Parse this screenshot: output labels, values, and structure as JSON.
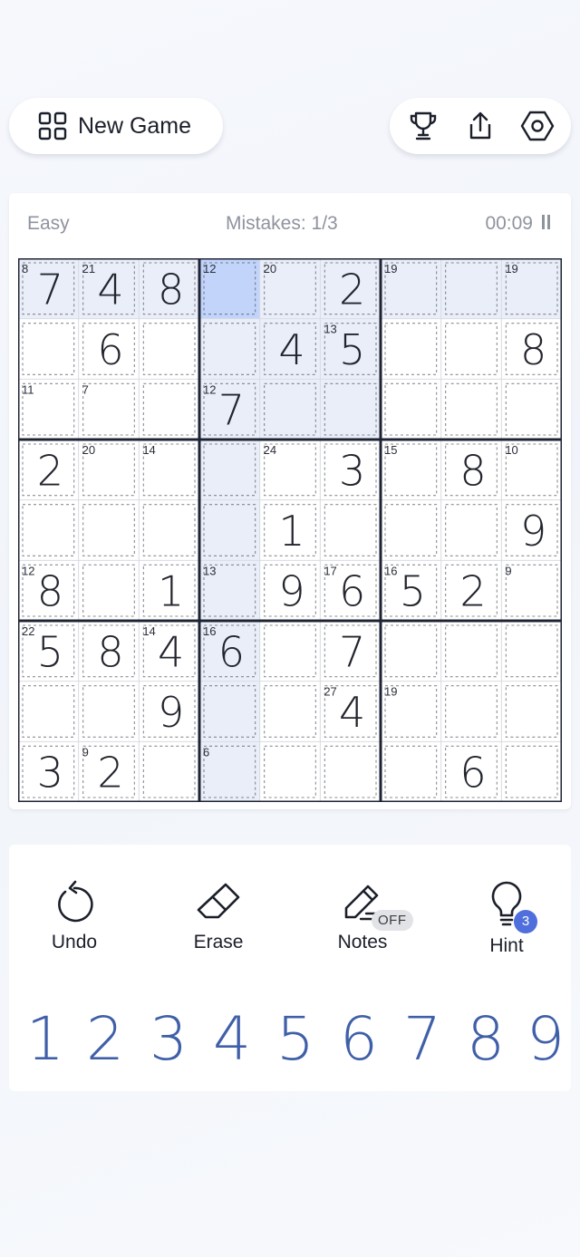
{
  "header": {
    "new_game_label": "New Game",
    "icons": [
      "grid-icon",
      "trophy-icon",
      "share-icon",
      "settings-icon"
    ]
  },
  "status": {
    "difficulty": "Easy",
    "mistakes": "Mistakes: 1/3",
    "timer": "00:09"
  },
  "board": {
    "digits": [
      [
        "7",
        "4",
        "8",
        "",
        "",
        "2",
        "",
        "",
        ""
      ],
      [
        "",
        "6",
        "",
        "",
        "4",
        "5",
        "",
        "",
        "8"
      ],
      [
        "",
        "",
        "",
        "7",
        "",
        "",
        "",
        "",
        ""
      ],
      [
        "2",
        "",
        "",
        "",
        "",
        "3",
        "",
        "8",
        ""
      ],
      [
        "",
        "",
        "",
        "",
        "1",
        "",
        "",
        "",
        "9"
      ],
      [
        "8",
        "",
        "1",
        "",
        "9",
        "6",
        "5",
        "2",
        ""
      ],
      [
        "5",
        "8",
        "4",
        "6",
        "",
        "7",
        "",
        "",
        ""
      ],
      [
        "",
        "",
        "9",
        "",
        "",
        "4",
        "",
        "",
        ""
      ],
      [
        "3",
        "2",
        "",
        "",
        "",
        "",
        "",
        "6",
        ""
      ]
    ],
    "cage_sums": [
      {
        "r": 0,
        "c": 0,
        "v": "8"
      },
      {
        "r": 0,
        "c": 1,
        "v": "21"
      },
      {
        "r": 0,
        "c": 3,
        "v": "12"
      },
      {
        "r": 0,
        "c": 4,
        "v": "20"
      },
      {
        "r": 0,
        "c": 6,
        "v": "19"
      },
      {
        "r": 0,
        "c": 8,
        "v": "19"
      },
      {
        "r": 1,
        "c": 5,
        "v": "13"
      },
      {
        "r": 2,
        "c": 0,
        "v": "11"
      },
      {
        "r": 2,
        "c": 1,
        "v": "7"
      },
      {
        "r": 2,
        "c": 3,
        "v": "12"
      },
      {
        "r": 3,
        "c": 1,
        "v": "20"
      },
      {
        "r": 3,
        "c": 2,
        "v": "14"
      },
      {
        "r": 3,
        "c": 4,
        "v": "24"
      },
      {
        "r": 3,
        "c": 6,
        "v": "15"
      },
      {
        "r": 3,
        "c": 8,
        "v": "10"
      },
      {
        "r": 5,
        "c": 0,
        "v": "12"
      },
      {
        "r": 5,
        "c": 3,
        "v": "13"
      },
      {
        "r": 5,
        "c": 5,
        "v": "17"
      },
      {
        "r": 5,
        "c": 6,
        "v": "16"
      },
      {
        "r": 5,
        "c": 8,
        "v": "9"
      },
      {
        "r": 6,
        "c": 0,
        "v": "22"
      },
      {
        "r": 6,
        "c": 2,
        "v": "14"
      },
      {
        "r": 6,
        "c": 3,
        "v": "16"
      },
      {
        "r": 7,
        "c": 5,
        "v": "27"
      },
      {
        "r": 7,
        "c": 6,
        "v": "19"
      },
      {
        "r": 8,
        "c": 1,
        "v": "9"
      },
      {
        "r": 8,
        "c": 3,
        "v": "6"
      }
    ],
    "selected": {
      "row": 0,
      "col": 3
    },
    "colors": {
      "selected": "#c3d4fb",
      "related": "#eaeef8",
      "digit": "#22252d",
      "thick_line": "#1f2435",
      "thin_line": "#d7dbe3"
    }
  },
  "tools": [
    {
      "label": "Undo",
      "icon": "undo-icon"
    },
    {
      "label": "Erase",
      "icon": "eraser-icon"
    },
    {
      "label": "Notes",
      "icon": "pencil-icon",
      "badge": "OFF"
    },
    {
      "label": "Hint",
      "icon": "lightbulb-icon",
      "badge": "3"
    }
  ],
  "numpad": [
    "1",
    "2",
    "3",
    "4",
    "5",
    "6",
    "7",
    "8",
    "9"
  ]
}
